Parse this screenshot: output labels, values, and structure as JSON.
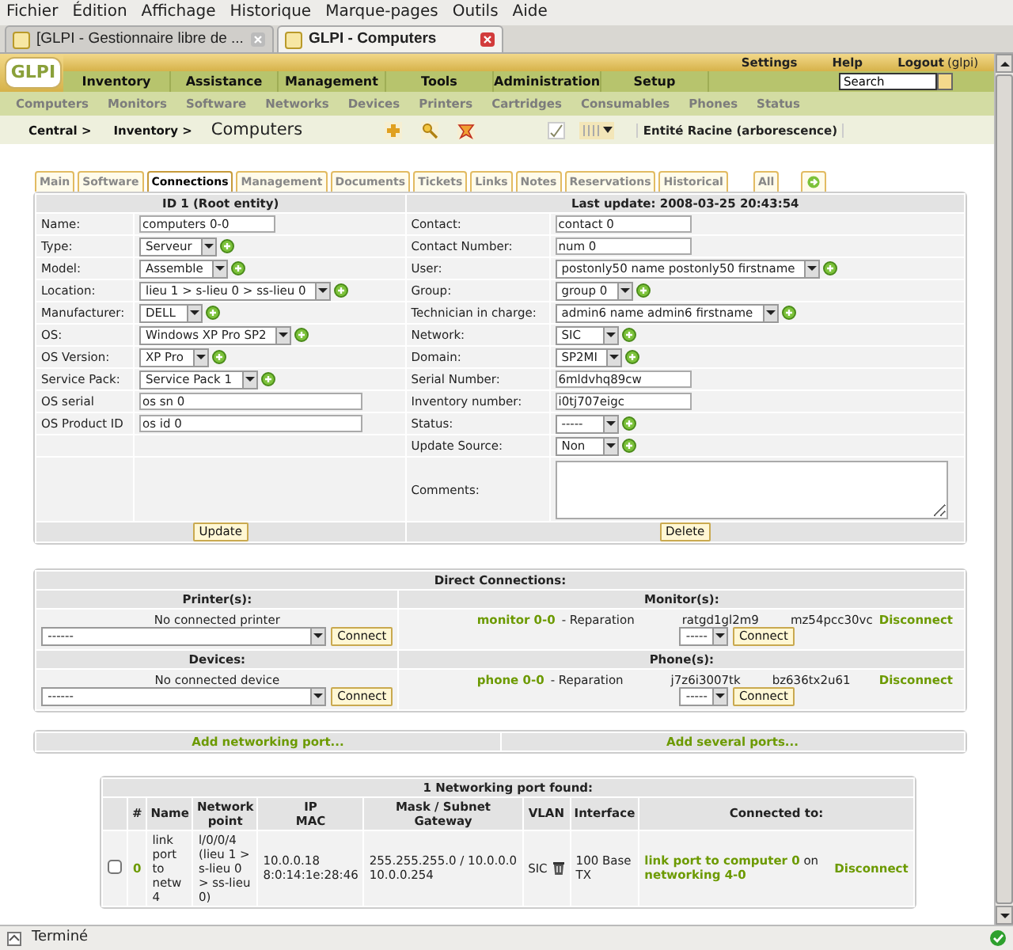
{
  "browser": {
    "menu": [
      "Fichier",
      "Édition",
      "Affichage",
      "Historique",
      "Marque-pages",
      "Outils",
      "Aide"
    ],
    "tabs": [
      {
        "title": "[GLPI - Gestionnaire libre de ...",
        "selected": false
      },
      {
        "title": "GLPI - Computers",
        "selected": true
      }
    ],
    "status": "Terminé"
  },
  "header": {
    "logo": "GLPI",
    "top_links": [
      "Settings",
      "Help",
      "Logout"
    ],
    "user": "(glpi)",
    "main_menu": [
      "Inventory",
      "Assistance",
      "Management",
      "Tools",
      "Administration",
      "Setup"
    ],
    "search": {
      "value": "Search"
    },
    "sub_menu": [
      "Computers",
      "Monitors",
      "Software",
      "Networks",
      "Devices",
      "Printers",
      "Cartridges",
      "Consumables",
      "Phones",
      "Status"
    ],
    "breadcrumb": [
      "Central >",
      "Inventory >"
    ],
    "page_title": "Computers",
    "entity": "Entité Racine (arborescence)"
  },
  "tabs": [
    {
      "kind": "tab",
      "label": "Main",
      "selected": false
    },
    {
      "kind": "tab",
      "label": "Software",
      "selected": false
    },
    {
      "kind": "tab",
      "label": "Connections",
      "selected": true
    },
    {
      "kind": "tab",
      "label": "Management",
      "selected": false
    },
    {
      "kind": "tab",
      "label": "Documents",
      "selected": false
    },
    {
      "kind": "tab",
      "label": "Tickets",
      "selected": false
    },
    {
      "kind": "tab",
      "label": "Links",
      "selected": false
    },
    {
      "kind": "tab",
      "label": "Notes",
      "selected": false
    },
    {
      "kind": "tab",
      "label": "Reservations",
      "selected": false
    },
    {
      "kind": "tab",
      "label": "Historical",
      "selected": false
    },
    {
      "kind": "all",
      "label": "All",
      "selected": false
    },
    {
      "kind": "next",
      "selected": false
    }
  ],
  "form": {
    "left_title": "ID 1 (Root entity)",
    "right_title": "Last update: 2008-03-25 20:43:54",
    "left_fields": [
      {
        "label": "Name:",
        "kind": "text",
        "value": "computers 0-0"
      },
      {
        "label": "Type:",
        "kind": "select",
        "value": "Serveur"
      },
      {
        "label": "Model:",
        "kind": "select",
        "value": "Assemble"
      },
      {
        "label": "Location:",
        "kind": "select",
        "value": "lieu 1 > s-lieu 0 > ss-lieu 0"
      },
      {
        "label": "Manufacturer:",
        "kind": "select",
        "value": "DELL"
      },
      {
        "label": "OS:",
        "kind": "select",
        "value": "Windows XP Pro SP2"
      },
      {
        "label": "OS Version:",
        "kind": "select",
        "value": "XP Pro"
      },
      {
        "label": "Service Pack:",
        "kind": "select",
        "value": "Service Pack 1"
      },
      {
        "label": "OS serial",
        "kind": "wide",
        "value": "os sn 0"
      },
      {
        "label": "OS Product ID",
        "kind": "wide",
        "value": "os id 0"
      }
    ],
    "right_fields": [
      {
        "label": "Contact:",
        "kind": "text",
        "value": "contact 0"
      },
      {
        "label": "Contact Number:",
        "kind": "text",
        "value": "num 0"
      },
      {
        "label": "User:",
        "kind": "select",
        "value": "postonly50 name postonly50 firstname"
      },
      {
        "label": "Group:",
        "kind": "select",
        "value": "group 0"
      },
      {
        "label": "Technician in charge:",
        "kind": "select",
        "value": "admin6 name admin6 firstname"
      },
      {
        "label": "Network:",
        "kind": "select",
        "value": "SIC"
      },
      {
        "label": "Domain:",
        "kind": "select",
        "value": "SP2MI"
      },
      {
        "label": "Serial Number:",
        "kind": "text",
        "value": "6mldvhq89cw"
      },
      {
        "label": "Inventory number:",
        "kind": "text",
        "value": "i0tj707eigc"
      },
      {
        "label": "Status:",
        "kind": "select",
        "value": "-----"
      },
      {
        "label": "Update Source:",
        "kind": "select",
        "value": "Non"
      },
      {
        "label": "Comments:",
        "kind": "textarea"
      }
    ],
    "update_button": "Update",
    "delete_button": "Delete"
  },
  "direct_connections": {
    "title": "Direct Connections:",
    "sections": [
      {
        "title": "Printer(s):",
        "empty": "No connected printer",
        "select": "------",
        "connect": "Connect"
      },
      {
        "title": "Monitor(s):",
        "items": [
          {
            "name": "monitor 0-0",
            "state": "- Reparation",
            "serial": "ratgd1gl2m9",
            "otherserial": "mz54pcc30vc",
            "disconnect": "Disconnect"
          }
        ],
        "select": "-----",
        "connect": "Connect"
      },
      {
        "title": "Devices:",
        "empty": "No connected device",
        "select": "------",
        "connect": "Connect"
      },
      {
        "title": "Phone(s):",
        "items": [
          {
            "name": "phone 0-0",
            "state": "- Reparation",
            "serial": "j7z6i3007tk",
            "otherserial": "bz636tx2u61",
            "disconnect": "Disconnect"
          }
        ],
        "select": "-----",
        "connect": "Connect"
      }
    ]
  },
  "port_actions": [
    "Add networking port...",
    "Add several ports..."
  ],
  "ports_table": {
    "title": "1 Networking port found:",
    "columns": [
      [
        "#"
      ],
      [
        "Name"
      ],
      [
        "Network",
        "point"
      ],
      [
        "IP",
        "MAC"
      ],
      [
        "Mask / Subnet",
        "Gateway"
      ],
      [
        "VLAN"
      ],
      [
        "Interface"
      ],
      [
        "Connected to:"
      ]
    ],
    "rows": [
      {
        "checked": false,
        "id": "0",
        "name": "link port to netw 4",
        "network_point": "l/0/0/4 (lieu 1 > s-lieu 0 > ss-lieu 0)",
        "ip": "10.0.0.18",
        "mac": "8:0:14:1e:28:46",
        "mask": "255.255.255.0 / 10.0.0.0",
        "gateway": "10.0.0.254",
        "vlan": "SIC",
        "interface": "100 Base TX",
        "connection": {
          "port": "link port to computer 0",
          "joiner": "on",
          "device": "networking 4-0"
        },
        "disconnect": "Disconnect"
      }
    ]
  }
}
